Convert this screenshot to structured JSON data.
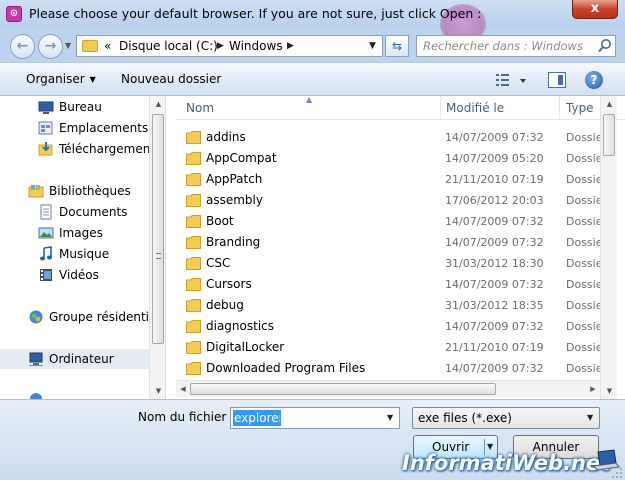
{
  "window": {
    "title": "Please choose your default browser. If you are not sure, just click Open :",
    "close_glyph": "x"
  },
  "address_bar": {
    "overflow": "«",
    "crumbs": [
      "Disque local (C:)",
      "Windows"
    ],
    "search_placeholder": "Rechercher dans : Windows"
  },
  "toolbar": {
    "organize_label": "Organiser",
    "new_folder_label": "Nouveau dossier",
    "help_glyph": "?"
  },
  "nav": {
    "items": [
      {
        "label": "Bureau",
        "icon": "desktop-icon"
      },
      {
        "label": "Emplacements ré",
        "icon": "recent-places-icon"
      },
      {
        "label": "Téléchargements",
        "icon": "downloads-folder-icon"
      },
      {
        "label": "Bibliothèques",
        "icon": "libraries-icon"
      },
      {
        "label": "Documents",
        "icon": "documents-icon"
      },
      {
        "label": "Images",
        "icon": "images-icon"
      },
      {
        "label": "Musique",
        "icon": "music-icon"
      },
      {
        "label": "Vidéos",
        "icon": "videos-icon"
      },
      {
        "label": "Groupe résidentiel",
        "icon": "homegroup-icon"
      },
      {
        "label": "Ordinateur",
        "icon": "computer-icon"
      }
    ]
  },
  "columns": {
    "name": "Nom",
    "modified": "Modifié le",
    "type": "Type"
  },
  "files": [
    {
      "name": "addins",
      "modified": "14/07/2009 07:32",
      "type": "Dossie"
    },
    {
      "name": "AppCompat",
      "modified": "14/07/2009 05:20",
      "type": "Dossie"
    },
    {
      "name": "AppPatch",
      "modified": "21/11/2010 07:19",
      "type": "Dossie"
    },
    {
      "name": "assembly",
      "modified": "17/06/2012 20:03",
      "type": "Dossie"
    },
    {
      "name": "Boot",
      "modified": "14/07/2009 07:32",
      "type": "Dossie"
    },
    {
      "name": "Branding",
      "modified": "14/07/2009 07:32",
      "type": "Dossie"
    },
    {
      "name": "CSC",
      "modified": "31/03/2012 18:30",
      "type": "Dossie"
    },
    {
      "name": "Cursors",
      "modified": "14/07/2009 07:32",
      "type": "Dossie"
    },
    {
      "name": "debug",
      "modified": "31/03/2012 18:35",
      "type": "Dossie"
    },
    {
      "name": "diagnostics",
      "modified": "14/07/2009 07:32",
      "type": "Dossie"
    },
    {
      "name": "DigitalLocker",
      "modified": "21/11/2010 07:19",
      "type": "Dossie"
    },
    {
      "name": "Downloaded Program Files",
      "modified": "14/07/2009 07:32",
      "type": "Dossie"
    }
  ],
  "bottom": {
    "filename_label": "Nom du fichier :",
    "filename_value": "explorer",
    "filetype_value": "exe files (*.exe)",
    "open_label": "Ouvrir",
    "cancel_label": "Annuler"
  },
  "watermark": {
    "text": "InformatiWeb.net"
  },
  "colors": {
    "folder": "#f2cc55",
    "selection": "#3399ff",
    "title_bar": "#cfe0f4",
    "close_button": "#c8442a"
  }
}
